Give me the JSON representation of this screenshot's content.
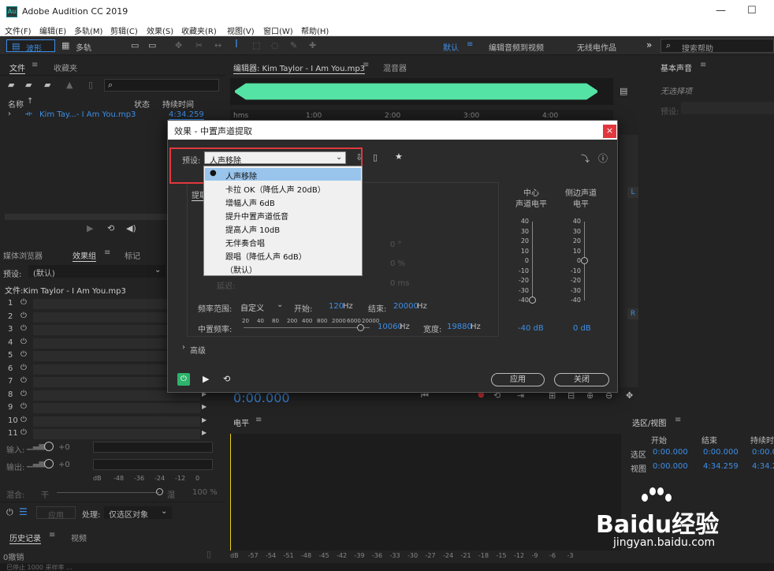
{
  "app": {
    "title": "Adobe Audition CC 2019",
    "logo": "Au"
  },
  "window_controls": {
    "minimize": "—",
    "maximize": "☐"
  },
  "menu": [
    "文件(F)",
    "编辑(E)",
    "多轨(M)",
    "剪辑(C)",
    "效果(S)",
    "收藏夹(R)",
    "视图(V)",
    "窗口(W)",
    "帮助(H)"
  ],
  "toolbar": {
    "waveform_label": "波形",
    "multitrack_label": "多轨",
    "workspaces": [
      "默认",
      "编辑音频到视频",
      "无线电作品"
    ],
    "more": "»",
    "search_placeholder": "搜索帮助"
  },
  "files_panel": {
    "tabs": [
      "文件",
      "收藏夹"
    ],
    "columns": [
      "名称",
      "状态",
      "持续时间"
    ],
    "file": {
      "name": "Kim Tay...- I Am You.mp3",
      "duration": "4:34.259"
    }
  },
  "editor": {
    "tab": "编辑器: Kim Taylor - I Am You.mp3",
    "mixer_tab": "混音器",
    "ruler": [
      "hms",
      "1:00",
      "2:00",
      "3:00",
      "4:00"
    ],
    "channel_l": "L",
    "channel_r": "R",
    "time": "0:00.000"
  },
  "essential_sound": {
    "title": "基本声音",
    "none_selected": "无选择项",
    "preset_label": "预设:"
  },
  "effects_panel": {
    "tabs": [
      "媒体浏览器",
      "效果组",
      "标记"
    ],
    "preset_label": "预设:",
    "preset_value": "(默认)",
    "file_label": "文件:Kim Taylor - I Am You.mp3",
    "slots": [
      "1",
      "2",
      "3",
      "4",
      "5",
      "6",
      "7",
      "8",
      "9",
      "10",
      "11"
    ],
    "input_label": "输入:",
    "output_label": "输出:",
    "level_db": "+0",
    "db_scale": [
      "dB",
      "-48",
      "-36",
      "-24",
      "-12",
      "0"
    ],
    "mix_label": "混合:",
    "dry_label": "干",
    "wet_label": "湿",
    "mix_pct": "100 %",
    "apply_label": "应用",
    "process_label": "处理:",
    "process_value": "仅选区对象"
  },
  "history_panel": {
    "tabs": [
      "历史记录",
      "视频"
    ],
    "undo_count": "0撤销"
  },
  "level_panel": {
    "title": "电平",
    "scale": [
      "dB",
      "-57",
      "-54",
      "-51",
      "-48",
      "-45",
      "-42",
      "-39",
      "-36",
      "-33",
      "-30",
      "-27",
      "-24",
      "-21",
      "-18",
      "-15",
      "-12",
      "-9",
      "-6",
      "-3"
    ]
  },
  "selection_view_panel": {
    "title": "选区/视图",
    "headers": [
      "开始",
      "结束",
      "持续时"
    ],
    "rows": [
      {
        "label": "选区",
        "start": "0:00.000",
        "end": "0:00.000",
        "duration": "0:00.0"
      },
      {
        "label": "视图",
        "start": "0:00.000",
        "end": "4:34.259",
        "duration": "4:34.2"
      }
    ]
  },
  "dialog": {
    "title": "效果 - 中置声道提取",
    "close": "×",
    "preset_label": "预设:",
    "preset_value": "人声移除",
    "options": [
      "人声移除",
      "卡拉 OK（降低人声 20dB）",
      "增幅人声 6dB",
      "提升中置声道低音",
      "提高人声 10dB",
      "无伴奏合唱",
      "跟唱（降低人声 6dB）",
      "（默认）"
    ],
    "selected_index": 0,
    "tab_extract": "提取",
    "center_level_label": "中心\n声道电平",
    "side_level_label": "侧边声道\n电平",
    "meter_scale": [
      "40",
      "30",
      "20",
      "10",
      "0",
      "-10",
      "-20",
      "-30",
      "-40"
    ],
    "center_value": -40,
    "center_readout": "-40 dB",
    "side_value": 0,
    "side_readout": "0 dB",
    "obscured_values": [
      "0 °",
      "0 %",
      "0 ms"
    ],
    "delay_label": "延迟:",
    "freq_range_label": "频率范围:",
    "freq_range_value": "自定义",
    "start_label": "开始:",
    "start_value": "120",
    "end_label": "结束:",
    "end_value": "20000",
    "hz": "Hz",
    "center_freq_label": "中置频率:",
    "freq_scale": [
      "20",
      "40",
      "80",
      "200",
      "400",
      "800",
      "2000",
      "6000",
      "20000"
    ],
    "center_freq_value": "10060",
    "width_label": "宽度:",
    "width_value": "19880",
    "advanced": "高级",
    "apply": "应用",
    "close_btn": "关闭"
  },
  "status_bar": "已停止 1000 采样率 ...",
  "watermark": {
    "brand": "Baidu经验",
    "url": "jingyan.baidu.com"
  },
  "colors": {
    "accent": "#3d8ee6",
    "waveform": "#54e3a4",
    "highlight": "#e0383e",
    "power_on": "#2db36b"
  }
}
